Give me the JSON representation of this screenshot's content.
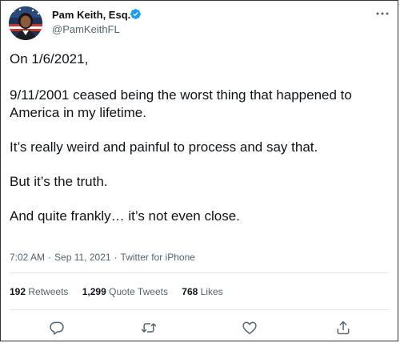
{
  "author": {
    "name": "Pam Keith, Esq.",
    "handle": "@PamKeithFL",
    "verified": true
  },
  "tweet": {
    "paragraphs": [
      "On 1/6/2021,",
      "9/11/2001 ceased being the worst thing that happened to America in my lifetime.",
      "It’s really weird and painful to process and say that.",
      "But it’s the truth.",
      "And quite frankly… it’s not even close."
    ],
    "time": "7:02 AM",
    "date": "Sep 11, 2021",
    "source": "Twitter for iPhone",
    "separator": "·"
  },
  "stats": {
    "retweets": {
      "count": "192",
      "label": "Retweets"
    },
    "quote_tweets": {
      "count": "1,299",
      "label": "Quote Tweets"
    },
    "likes": {
      "count": "768",
      "label": "Likes"
    }
  },
  "icons": {
    "verified": "verified-badge-icon",
    "more": "more-options-icon",
    "reply": "reply-icon",
    "retweet": "retweet-icon",
    "like": "heart-icon",
    "share": "share-icon"
  },
  "colors": {
    "verified_blue": "#1d9bf0",
    "text_primary": "#0f1419",
    "text_secondary": "#536471",
    "divider": "#e4e6e8"
  }
}
